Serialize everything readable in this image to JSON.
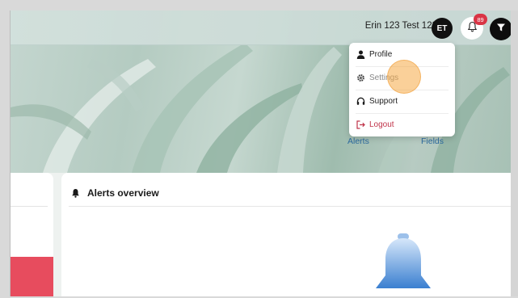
{
  "header": {
    "user_name": "Erin 123 Test 123",
    "avatar_initials": "ET",
    "notification_count": "89"
  },
  "nav": {
    "alerts": "Alerts",
    "fields": "Fields"
  },
  "user_menu": {
    "items": [
      {
        "label": "Profile",
        "icon": "person-icon"
      },
      {
        "label": "Settings",
        "icon": "gear-icon"
      },
      {
        "label": "Support",
        "icon": "headset-icon"
      },
      {
        "label": "Logout",
        "icon": "logout-icon",
        "color": "#c0344a"
      }
    ]
  },
  "alerts_overview": {
    "title": "Alerts overview"
  },
  "colors": {
    "accent_link": "#2c6a9e",
    "danger": "#e74c5e",
    "bell_gradient_top": "#cfe2f8",
    "bell_gradient_bottom": "#3a7fd0"
  }
}
